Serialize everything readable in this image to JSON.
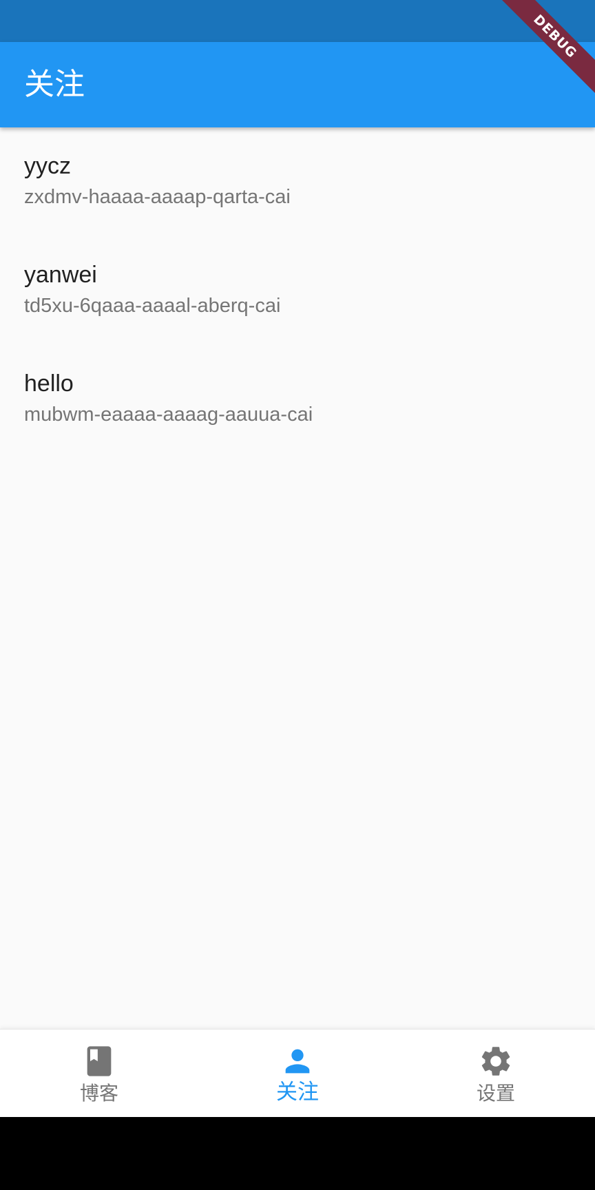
{
  "app_bar": {
    "title": "关注",
    "debug_label": "DEBUG"
  },
  "follows": [
    {
      "name": "yycz",
      "id": "zxdmv-haaaa-aaaap-qarta-cai"
    },
    {
      "name": "yanwei",
      "id": "td5xu-6qaaa-aaaal-aberq-cai"
    },
    {
      "name": "hello",
      "id": "mubwm-eaaaa-aaaag-aauua-cai"
    }
  ],
  "bottom_nav": {
    "items": [
      {
        "label": "博客",
        "icon": "book-icon",
        "active": false
      },
      {
        "label": "关注",
        "icon": "person-icon",
        "active": true
      },
      {
        "label": "设置",
        "icon": "gear-icon",
        "active": false
      }
    ]
  },
  "colors": {
    "primary": "#2196f3",
    "status_bar": "#1a74bb",
    "inactive": "#757575",
    "debug_banner": "#7a2a40"
  }
}
